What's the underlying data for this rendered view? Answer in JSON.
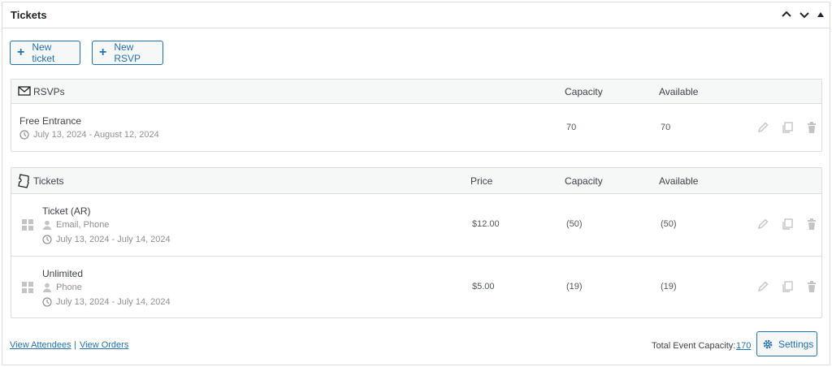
{
  "panel": {
    "title": "Tickets"
  },
  "toolbar": {
    "new_ticket_label": "New ticket",
    "new_rsvp_label": "New RSVP"
  },
  "rsvp_table": {
    "header": {
      "title": "RSVPs",
      "capacity": "Capacity",
      "available": "Available"
    },
    "rows": [
      {
        "name": "Free Entrance",
        "dates": "July 13, 2024 - August 12, 2024",
        "capacity": "70",
        "available": "70"
      }
    ]
  },
  "ticket_table": {
    "header": {
      "title": "Tickets",
      "price": "Price",
      "capacity": "Capacity",
      "available": "Available"
    },
    "rows": [
      {
        "name": "Ticket (AR)",
        "fields": "Email, Phone",
        "dates": "July 13, 2024 - July 14, 2024",
        "price": "$12.00",
        "capacity": "(50)",
        "available": "(50)"
      },
      {
        "name": "Unlimited",
        "fields": "Phone",
        "dates": "July 13, 2024 - July 14, 2024",
        "price": "$5.00",
        "capacity": "(19)",
        "available": "(19)"
      }
    ]
  },
  "footer": {
    "view_attendees": "View Attendees",
    "separator": "|",
    "view_orders": "View Orders",
    "total_capacity_label": "Total Event Capacity:",
    "total_capacity_value": "170",
    "settings_label": "Settings"
  },
  "colors": {
    "accent": "#2271b1",
    "border": "#dcdcde",
    "muted": "#8c8f94"
  }
}
